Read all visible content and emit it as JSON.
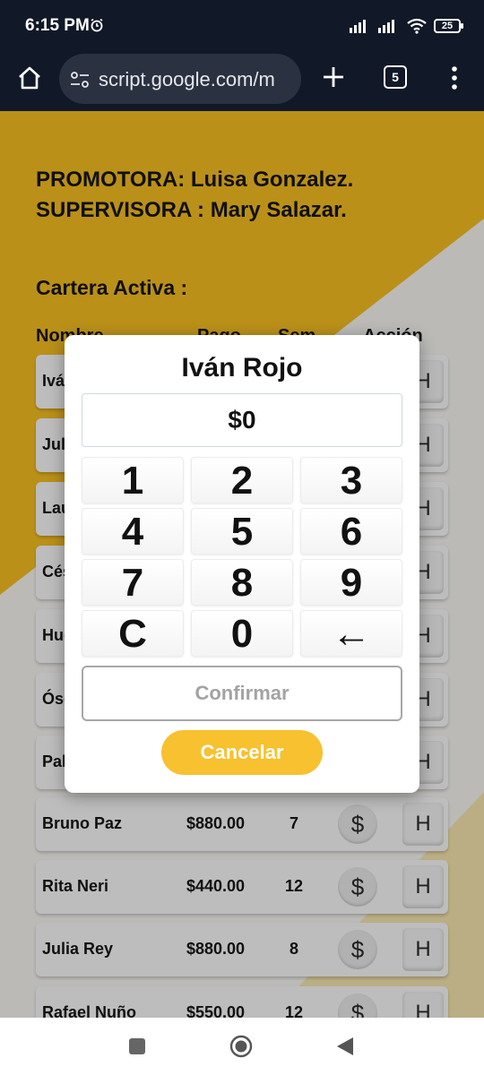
{
  "status_bar": {
    "time": "6:15 PM",
    "battery": "25"
  },
  "browser": {
    "url": "script.google.com/m",
    "tab_count": "5"
  },
  "page": {
    "promotora": "PROMOTORA: Luisa Gonzalez.",
    "supervisora": "SUPERVISORA : Mary Salazar.",
    "cartera_title": "Cartera Activa :",
    "columns": {
      "nombre": "Nombre",
      "pago": "Pago",
      "sem": "Sem",
      "accion": "Acción"
    },
    "rows": [
      {
        "name": "Iván Rojo",
        "amount": "",
        "weeks": ""
      },
      {
        "name": "Julio",
        "amount": "",
        "weeks": ""
      },
      {
        "name": "Laura",
        "amount": "",
        "weeks": ""
      },
      {
        "name": "César",
        "amount": "",
        "weeks": ""
      },
      {
        "name": "Hugo",
        "amount": "",
        "weeks": ""
      },
      {
        "name": "Óscar",
        "amount": "",
        "weeks": ""
      },
      {
        "name": "Pablo",
        "amount": "",
        "weeks": ""
      },
      {
        "name": "Bruno Paz",
        "amount": "$880.00",
        "weeks": "7"
      },
      {
        "name": "Rita Neri",
        "amount": "$440.00",
        "weeks": "12"
      },
      {
        "name": "Julia Rey",
        "amount": "$880.00",
        "weeks": "8"
      },
      {
        "name": "Rafael Nuño",
        "amount": "$550.00",
        "weeks": "12"
      }
    ],
    "pay_label": "$",
    "history_label": "H"
  },
  "modal": {
    "title": "Iván Rojo",
    "amount": "$0",
    "keys": [
      "1",
      "2",
      "3",
      "4",
      "5",
      "6",
      "7",
      "8",
      "9",
      "C",
      "0",
      "←"
    ],
    "confirm_label": "Confirmar",
    "cancel_label": "Cancelar"
  },
  "colors": {
    "accent_yellow": "#f7c12f",
    "page_gold": "#c69a1b",
    "page_gray": "#c7c6c3"
  }
}
